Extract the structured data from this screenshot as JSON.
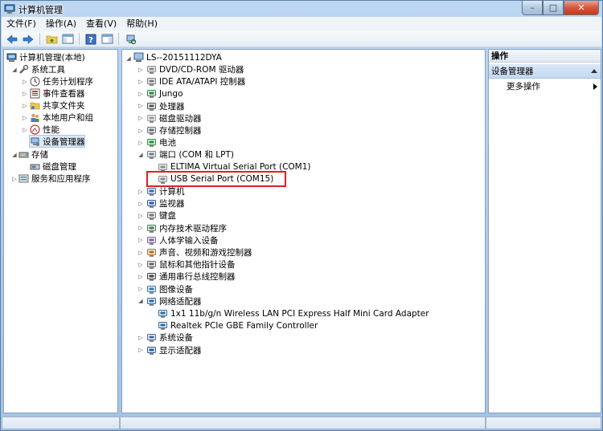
{
  "window": {
    "title": "计算机管理",
    "minimize": "–",
    "maximize": "□",
    "close": "✕"
  },
  "menu": [
    "文件(F)",
    "操作(A)",
    "查看(V)",
    "帮助(H)"
  ],
  "left_tree": {
    "root": "计算机管理(本地)",
    "items": [
      {
        "label": "系统工具",
        "level": 1,
        "expander": "◢"
      },
      {
        "label": "任务计划程序",
        "level": 2,
        "expander": "▷"
      },
      {
        "label": "事件查看器",
        "level": 2,
        "expander": "▷"
      },
      {
        "label": "共享文件夹",
        "level": 2,
        "expander": "▷"
      },
      {
        "label": "本地用户和组",
        "level": 2,
        "expander": "▷"
      },
      {
        "label": "性能",
        "level": 2,
        "expander": "▷"
      },
      {
        "label": "设备管理器",
        "level": 2,
        "expander": ""
      },
      {
        "label": "存储",
        "level": 1,
        "expander": "◢"
      },
      {
        "label": "磁盘管理",
        "level": 2,
        "expander": ""
      },
      {
        "label": "服务和应用程序",
        "level": 1,
        "expander": "▷"
      }
    ]
  },
  "device_tree": {
    "root": "LS--20151112DYA",
    "items": [
      {
        "label": "DVD/CD-ROM 驱动器",
        "level": 1,
        "expander": "▷",
        "icon": "dvd-drive-icon"
      },
      {
        "label": "IDE ATA/ATAPI 控制器",
        "level": 1,
        "expander": "▷",
        "icon": "ide-controller-icon"
      },
      {
        "label": "Jungo",
        "level": 1,
        "expander": "▷",
        "icon": "jungo-icon"
      },
      {
        "label": "处理器",
        "level": 1,
        "expander": "▷",
        "icon": "processor-icon"
      },
      {
        "label": "磁盘驱动器",
        "level": 1,
        "expander": "▷",
        "icon": "disk-drive-icon"
      },
      {
        "label": "存储控制器",
        "level": 1,
        "expander": "▷",
        "icon": "storage-controller-icon"
      },
      {
        "label": "电池",
        "level": 1,
        "expander": "▷",
        "icon": "battery-icon"
      },
      {
        "label": "端口 (COM 和 LPT)",
        "level": 1,
        "expander": "◢",
        "icon": "port-icon"
      },
      {
        "label": "ELTIMA Virtual Serial Port (COM1)",
        "level": 2,
        "expander": "",
        "icon": "serial-port-icon"
      },
      {
        "label": "USB Serial Port (COM15)",
        "level": 2,
        "expander": "",
        "icon": "serial-port-icon"
      },
      {
        "label": "计算机",
        "level": 1,
        "expander": "▷",
        "icon": "computer-icon"
      },
      {
        "label": "监视器",
        "level": 1,
        "expander": "▷",
        "icon": "monitor-icon"
      },
      {
        "label": "键盘",
        "level": 1,
        "expander": "▷",
        "icon": "keyboard-icon"
      },
      {
        "label": "内存技术驱动程序",
        "level": 1,
        "expander": "▷",
        "icon": "memory-driver-icon"
      },
      {
        "label": "人体学输入设备",
        "level": 1,
        "expander": "▷",
        "icon": "hid-icon"
      },
      {
        "label": "声音、视频和游戏控制器",
        "level": 1,
        "expander": "▷",
        "icon": "sound-icon"
      },
      {
        "label": "鼠标和其他指针设备",
        "level": 1,
        "expander": "▷",
        "icon": "mouse-icon"
      },
      {
        "label": "通用串行总线控制器",
        "level": 1,
        "expander": "▷",
        "icon": "usb-controller-icon"
      },
      {
        "label": "图像设备",
        "level": 1,
        "expander": "▷",
        "icon": "imaging-device-icon"
      },
      {
        "label": "网络适配器",
        "level": 1,
        "expander": "◢",
        "icon": "network-adapter-icon"
      },
      {
        "label": "1x1 11b/g/n Wireless LAN PCI Express Half Mini Card Adapter",
        "level": 2,
        "expander": "",
        "icon": "network-card-icon"
      },
      {
        "label": "Realtek PCIe GBE Family Controller",
        "level": 2,
        "expander": "",
        "icon": "network-card-icon"
      },
      {
        "label": "系统设备",
        "level": 1,
        "expander": "▷",
        "icon": "system-device-icon"
      },
      {
        "label": "显示适配器",
        "level": 1,
        "expander": "▷",
        "icon": "display-adapter-icon"
      }
    ]
  },
  "actions": {
    "header": "操作",
    "section": "设备管理器",
    "more": "更多操作"
  }
}
